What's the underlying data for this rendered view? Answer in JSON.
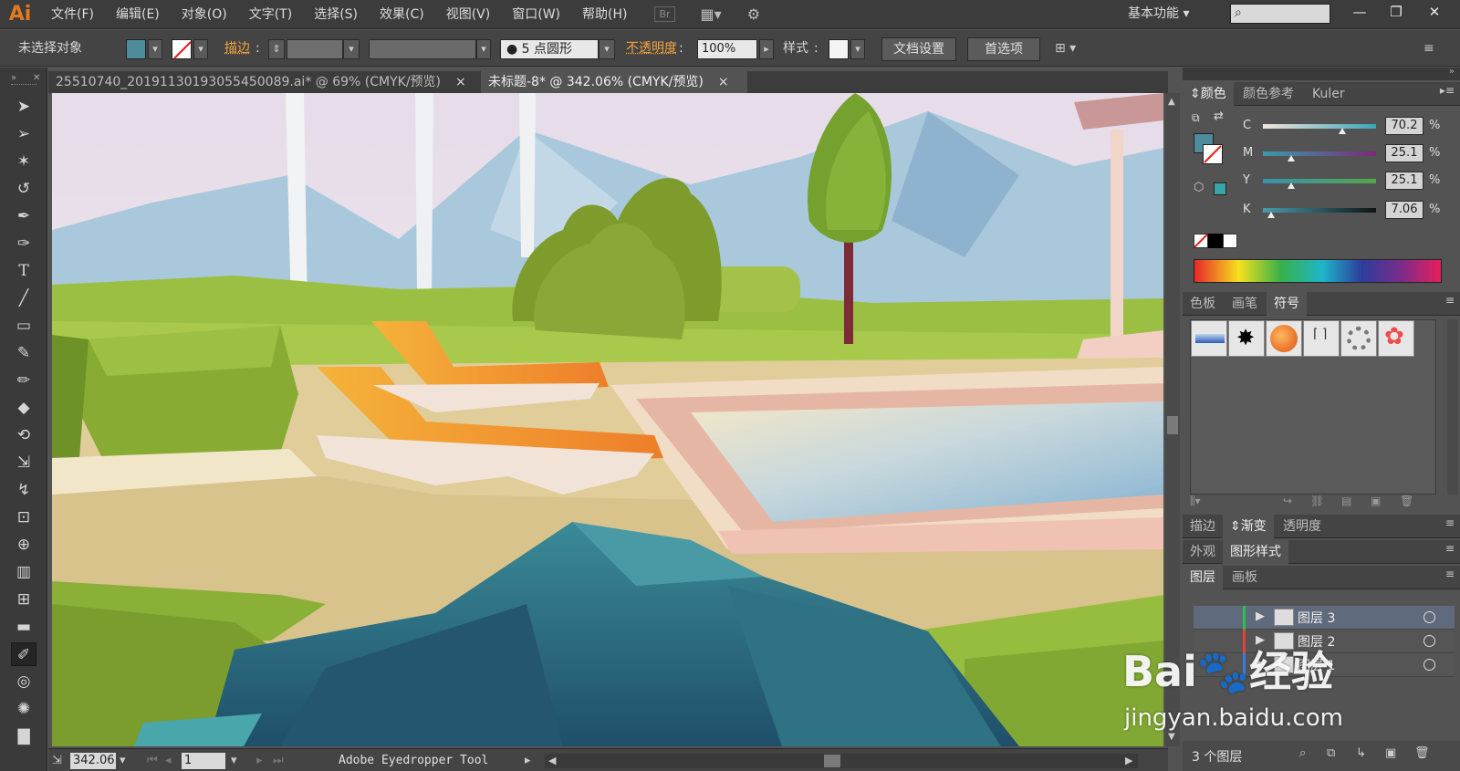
{
  "app": {
    "logo": "Ai",
    "menus": [
      "文件(F)",
      "编辑(E)",
      "对象(O)",
      "文字(T)",
      "选择(S)",
      "效果(C)",
      "视图(V)",
      "窗口(W)",
      "帮助(H)"
    ],
    "bridge_label": "Br",
    "workspace": "基本功能",
    "search_placeholder": "",
    "window_controls": [
      "minimize-icon",
      "restore-icon",
      "close-icon"
    ]
  },
  "control_bar": {
    "selection_status": "未选择对象",
    "fill_color": "#4f8c9b",
    "stroke_label": "描边",
    "brush_label": "5 点圆形",
    "opacity_label": "不透明度",
    "opacity_value": "100%",
    "style_label": "样式",
    "doc_setup_button": "文档设置",
    "preferences_button": "首选项"
  },
  "tabs": [
    {
      "title": "25510740_20191130193055450089.ai* @ 69% (CMYK/预览)",
      "close": "×"
    },
    {
      "title": "未标题-8* @ 342.06% (CMYK/预览)",
      "close": "×"
    }
  ],
  "status_bar": {
    "zoom": "342.06",
    "artboard": "1",
    "tool_name": "Adobe Eyedropper Tool"
  },
  "color_panel": {
    "tabs": [
      "颜色",
      "颜色参考",
      "Kuler"
    ],
    "channels": [
      {
        "label": "C",
        "value": "70.2",
        "pct": "%",
        "fraction": 0.702
      },
      {
        "label": "M",
        "value": "25.1",
        "pct": "%",
        "fraction": 0.251
      },
      {
        "label": "Y",
        "value": "25.1",
        "pct": "%",
        "fraction": 0.251
      },
      {
        "label": "K",
        "value": "7.06",
        "pct": "%",
        "fraction": 0.0706
      }
    ],
    "fill_color": "#4f8c9b",
    "gamut_color": "#3aa5a8"
  },
  "symbols_panel": {
    "tabs": [
      "色板",
      "画笔",
      "符号"
    ]
  },
  "gradient_tabs": [
    "描边",
    "渐变",
    "透明度"
  ],
  "appearance_tabs": [
    "外观",
    "图形样式"
  ],
  "layers_panel": {
    "tabs": [
      "图层",
      "画板"
    ],
    "layers": [
      {
        "name": "图层 3"
      },
      {
        "name": "图层 2"
      },
      {
        "name": "图层 1"
      }
    ],
    "count_label": "3 个图层"
  },
  "watermark": {
    "brand": "Bai",
    "brand2": "经验",
    "url": "jingyan.baidu.com"
  }
}
